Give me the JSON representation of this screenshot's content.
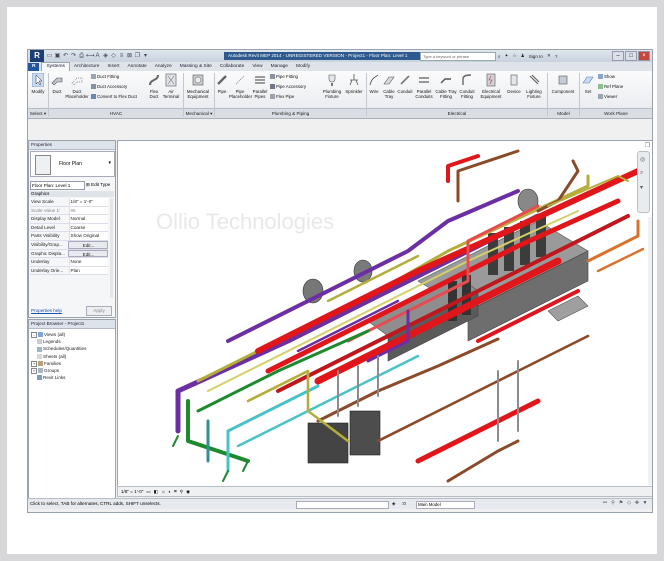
{
  "window": {
    "title": "Autodesk Revit MEP 2014 - UNREGISTERED VERSION -   Project1 - Floor Plan: Level 1",
    "search_placeholder": "Type a keyword or phrase",
    "sign_in": "Sign In",
    "logo": "R"
  },
  "tabs": [
    "Systems",
    "Architecture",
    "Insert",
    "Annotate",
    "Analyze",
    "Massing & Site",
    "Collaborate",
    "View",
    "Manage",
    "Modify"
  ],
  "app_button": "R",
  "ribbon": {
    "modify": "Modify",
    "duct": "Duct",
    "duct_placeholder": "Duct Placeholder",
    "duct_fitting": "Duct Fitting",
    "duct_accessory": "Duct Accessory",
    "convert_to_flex_duct": "Convert to Flex Duct",
    "flex_duct": "Flex Duct",
    "air_terminal": "Air Terminal",
    "mechanical_equipment": "Mechanical Equipment",
    "pipe": "Pipe",
    "pipe_placeholder": "Pipe Placeholder",
    "parallel_pipes": "Parallel Pipes",
    "pipe_fitting": "Pipe Fitting",
    "pipe_accessory": "Pipe Accessory",
    "flex_pipe": "Flex Pipe",
    "plumbing_fixture": "Plumbing Fixture",
    "sprinkler": "Sprinkler",
    "wire": "Wire",
    "cable_tray": "Cable Tray",
    "conduit": "Conduit",
    "parallel_conduits": "Parallel Conduits",
    "cable_tray_fitting": "Cable Tray Fitting",
    "conduit_fitting": "Conduit Fitting",
    "electrical_equipment": "Electrical Equipment",
    "device": "Device",
    "lighting_fixture": "Lighting Fixture",
    "component": "Component",
    "set": "Set",
    "show": "Show",
    "ref_plane": "Ref Plane",
    "viewer": "Viewer",
    "panels": {
      "select": "Select ▾",
      "hvac": "HVAC",
      "mechanical": "Mechanical ▾",
      "plumbing": "Plumbing & Piping",
      "electrical": "Electrical",
      "model": "Model",
      "work_plane": "Work Plane"
    }
  },
  "properties": {
    "header": "Properties",
    "type": "Floor Plan",
    "instance": "Floor Plan: Level 1",
    "edit_type": "Edit Type",
    "group": "Graphics",
    "rows": [
      {
        "k": "View Scale",
        "v": "1/8\" = 1'-0\""
      },
      {
        "k": "Scale Value   1:",
        "v": "96"
      },
      {
        "k": "Display Model",
        "v": "Normal"
      },
      {
        "k": "Detail Level",
        "v": "Coarse"
      },
      {
        "k": "Parts Visibility",
        "v": "Show Original"
      },
      {
        "k": "Visibility/Grap...",
        "v": "Edit..."
      },
      {
        "k": "Graphic Displa...",
        "v": "Edit..."
      },
      {
        "k": "Underlay",
        "v": "None"
      },
      {
        "k": "Underlay Orie...",
        "v": "Plan"
      }
    ],
    "help": "Properties help",
    "apply": "Apply"
  },
  "browser": {
    "header": "Project Browser - Project1",
    "items": [
      {
        "label": "Views (all)",
        "exp": "-"
      },
      {
        "label": "Legends",
        "exp": ""
      },
      {
        "label": "Schedules/Quantities",
        "exp": ""
      },
      {
        "label": "Sheets (all)",
        "exp": ""
      },
      {
        "label": "Families",
        "exp": "+"
      },
      {
        "label": "Groups",
        "exp": "+"
      },
      {
        "label": "Revit Links",
        "exp": ""
      }
    ]
  },
  "viewport": {
    "watermark": "Ollio Technologies",
    "scale": "1/8\" = 1'-0\""
  },
  "status": {
    "text": "Click to select, TAB for alternates, CTRL adds, SHIFT unselects.",
    "model": "Main Model",
    "zero": ":0"
  },
  "colors": {
    "red": "#e0161b",
    "purple": "#6b2fa3",
    "olive": "#b4ad3a",
    "brown": "#8b4a2a",
    "green": "#1d8a2e",
    "cyan": "#47c2c8",
    "gray": "#8c8c8c",
    "dark": "#3c3c3c",
    "orange": "#d9702b"
  }
}
